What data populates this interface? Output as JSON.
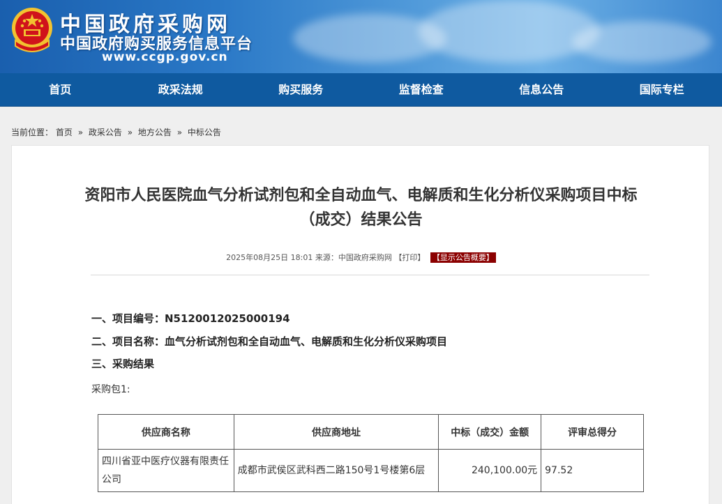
{
  "header": {
    "title": "中国政府采购网",
    "subtitle": "中国政府购买服务信息平台",
    "url": "www.ccgp.gov.cn",
    "colors": {
      "banner": "#2a78c6",
      "nav": "#0f5aa0",
      "emblem_red": "#d0131b",
      "emblem_gold": "#f2c230"
    }
  },
  "nav": {
    "items": [
      {
        "label": "首页"
      },
      {
        "label": "政采法规"
      },
      {
        "label": "购买服务"
      },
      {
        "label": "监督检查"
      },
      {
        "label": "信息公告"
      },
      {
        "label": "国际专栏"
      }
    ]
  },
  "breadcrumb": {
    "prefix": "当前位置：",
    "items": [
      {
        "label": "首页"
      },
      {
        "label": "政采公告"
      },
      {
        "label": "地方公告"
      },
      {
        "label": "中标公告"
      }
    ],
    "separator": "»"
  },
  "article": {
    "title_line1": "资阳市人民医院血气分析试剂包和全自动血气、电解质和生化分析仪采购项目中标",
    "title_line2": "（成交）结果公告",
    "meta": {
      "date": "2025年08月25日 18:01",
      "source": "来源：中国政府采购网",
      "print": "【打印】",
      "summary": "【显示公告概要】"
    },
    "items": [
      "一、项目编号：N5120012025000194",
      "二、项目名称：血气分析试剂包和全自动血气、电解质和生化分析仪采购项目",
      "三、采购结果"
    ],
    "package_label": "采购包1:",
    "table": {
      "headers": [
        "供应商名称",
        "供应商地址",
        "中标（成交）金额",
        "评审总得分"
      ],
      "rows": [
        [
          "四川省亚中医疗仪器有限责任公司",
          "成都市武侯区武科西二路150号1号楼第6层",
          "240,100.00元",
          "97.52"
        ]
      ]
    }
  }
}
